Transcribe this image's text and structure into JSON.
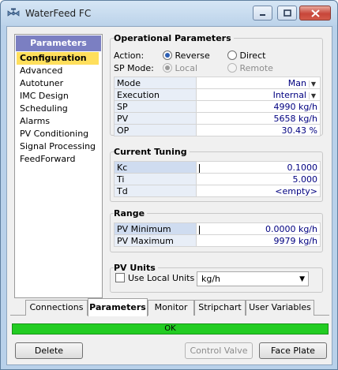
{
  "window": {
    "title": "WaterFeed FC"
  },
  "nav": {
    "header": "Parameters",
    "items": [
      {
        "label": "Configuration",
        "selected": true
      },
      {
        "label": "Advanced"
      },
      {
        "label": "Autotuner"
      },
      {
        "label": "IMC Design"
      },
      {
        "label": "Scheduling"
      },
      {
        "label": "Alarms"
      },
      {
        "label": "PV Conditioning"
      },
      {
        "label": "Signal Processing"
      },
      {
        "label": "FeedForward"
      }
    ]
  },
  "operational": {
    "title": "Operational Parameters",
    "action_label": "Action:",
    "action_reverse": "Reverse",
    "action_direct": "Direct",
    "spmode_label": "SP Mode:",
    "spmode_local": "Local",
    "spmode_remote": "Remote",
    "rows": [
      {
        "label": "Mode",
        "value": "Man"
      },
      {
        "label": "Execution",
        "value": "Internal"
      },
      {
        "label": "SP",
        "value": "4990 kg/h"
      },
      {
        "label": "PV",
        "value": "5658 kg/h"
      },
      {
        "label": "OP",
        "value": "30.43 %"
      }
    ]
  },
  "tuning": {
    "title": "Current Tuning",
    "rows": [
      {
        "label": "Kc",
        "value": "0.1000"
      },
      {
        "label": "Ti",
        "value": "5.000"
      },
      {
        "label": "Td",
        "value": "<empty>"
      }
    ]
  },
  "range": {
    "title": "Range",
    "rows": [
      {
        "label": "PV Minimum",
        "value": "0.0000 kg/h"
      },
      {
        "label": "PV Maximum",
        "value": "9979 kg/h"
      }
    ]
  },
  "pv_units": {
    "title": "PV Units",
    "checkbox_label": "Use Local Units",
    "unit_value": "kg/h"
  },
  "tabs": [
    {
      "label": "Connections"
    },
    {
      "label": "Parameters",
      "active": true
    },
    {
      "label": "Monitor"
    },
    {
      "label": "Stripchart"
    },
    {
      "label": "User Variables"
    }
  ],
  "status": {
    "text": "OK",
    "color": "#22cc22"
  },
  "buttons": {
    "delete": "Delete",
    "control_valve": "Control Valve",
    "face_plate": "Face Plate"
  }
}
